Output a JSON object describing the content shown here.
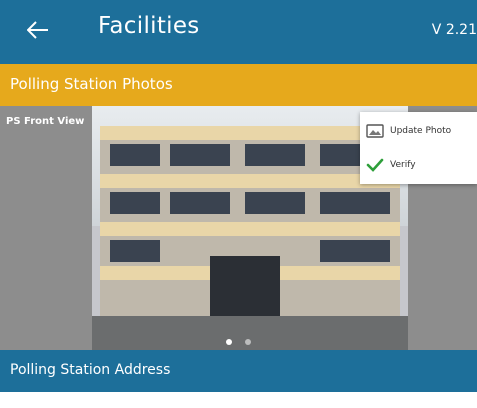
{
  "header": {
    "title": "Facilities",
    "version": "V 2.21",
    "back_icon": "arrow-left-icon",
    "colors": {
      "primary": "#1d6f9a"
    }
  },
  "photos_section": {
    "title": "Polling Station Photos",
    "color": "#e6a91c",
    "photo_label": "PS Front View",
    "carousel": {
      "pages": 2,
      "active": 1
    }
  },
  "photo_menu": {
    "items": [
      {
        "label": "Update Photo",
        "icon": "image-icon"
      },
      {
        "label": "Verify",
        "icon": "checkmark-icon",
        "icon_color": "#2e9f3a"
      }
    ]
  },
  "address_section": {
    "title": "Polling Station Address"
  }
}
